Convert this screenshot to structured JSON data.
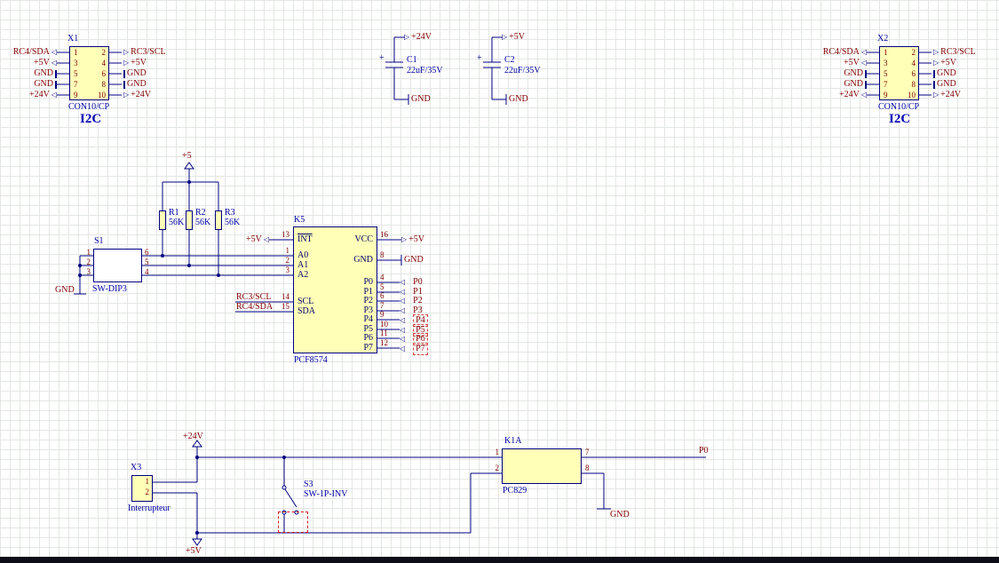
{
  "icons": {
    "port_in": "◁",
    "port_out": "▷"
  },
  "x1": {
    "designator": "X1",
    "type": "CON10/CP",
    "title": "I2C",
    "left": [
      {
        "num": "1",
        "label": "RC4/SDA"
      },
      {
        "num": "3",
        "label": "+5V"
      },
      {
        "num": "5",
        "label": "GND"
      },
      {
        "num": "7",
        "label": "GND"
      },
      {
        "num": "9",
        "label": "+24V"
      }
    ],
    "right": [
      {
        "num": "2",
        "label": "RC3/SCL"
      },
      {
        "num": "4",
        "label": "+5V"
      },
      {
        "num": "6",
        "label": "GND"
      },
      {
        "num": "8",
        "label": "GND"
      },
      {
        "num": "10",
        "label": "+24V"
      }
    ]
  },
  "x2": {
    "designator": "X2",
    "type": "CON10/CP",
    "title": "I2C",
    "left": [
      {
        "num": "1",
        "label": "RC4/SDA"
      },
      {
        "num": "3",
        "label": "+5V"
      },
      {
        "num": "5",
        "label": "GND"
      },
      {
        "num": "7",
        "label": "GND"
      },
      {
        "num": "9",
        "label": "+24V"
      }
    ],
    "right": [
      {
        "num": "2",
        "label": "RC3/SCL"
      },
      {
        "num": "4",
        "label": "+5V"
      },
      {
        "num": "6",
        "label": "GND"
      },
      {
        "num": "8",
        "label": "GND"
      },
      {
        "num": "10",
        "label": "+24V"
      }
    ]
  },
  "caps": {
    "c1": {
      "designator": "C1",
      "value": "22uF/35V",
      "polarity": "+",
      "top_net": "+24V",
      "bottom_net": "GND"
    },
    "c2": {
      "designator": "C2",
      "value": "22uF/35V",
      "polarity": "+",
      "top_net": "+5V",
      "bottom_net": "GND"
    }
  },
  "pullups": {
    "net": "+5",
    "resistors": [
      {
        "designator": "R1",
        "value": "56K"
      },
      {
        "designator": "R2",
        "value": "56K"
      },
      {
        "designator": "R3",
        "value": "56K"
      }
    ]
  },
  "s1": {
    "designator": "S1",
    "type": "SW-DIP3",
    "gnd": "GND",
    "left": [
      {
        "num": "1"
      },
      {
        "num": "2"
      },
      {
        "num": "3"
      }
    ],
    "right": [
      {
        "num": "6"
      },
      {
        "num": "5"
      },
      {
        "num": "4"
      }
    ]
  },
  "k5": {
    "designator": "K5",
    "type": "PCF8574",
    "left": [
      {
        "name": "INT",
        "num": "13",
        "net": "+5V"
      },
      {
        "name": "A0",
        "num": "1"
      },
      {
        "name": "A1",
        "num": "2"
      },
      {
        "name": "A2",
        "num": "3"
      },
      {
        "name": "SCL",
        "num": "14",
        "net": "RC3/SCL"
      },
      {
        "name": "SDA",
        "num": "15",
        "net": "RC4/SDA"
      }
    ],
    "right": [
      {
        "name": "VCC",
        "num": "16",
        "net": "+5V"
      },
      {
        "name": "GND",
        "num": "8",
        "net": "GND"
      },
      {
        "name": "P0",
        "num": "4",
        "net": "P0"
      },
      {
        "name": "P1",
        "num": "5",
        "net": "P1"
      },
      {
        "name": "P2",
        "num": "6",
        "net": "P2"
      },
      {
        "name": "P3",
        "num": "7",
        "net": "P3"
      },
      {
        "name": "P4",
        "num": "9",
        "net": "P4"
      },
      {
        "name": "P5",
        "num": "10",
        "net": "P5"
      },
      {
        "name": "P6",
        "num": "11",
        "net": "P6"
      },
      {
        "name": "P7",
        "num": "12",
        "net": "P7"
      }
    ]
  },
  "bottom": {
    "net_24v": "+24V",
    "net_5v": "+5V",
    "x3": {
      "designator": "X3",
      "type": "Interrupteur",
      "pins": [
        {
          "num": "1"
        },
        {
          "num": "2"
        }
      ]
    },
    "s3": {
      "designator": "S3",
      "type": "SW-1P-INV"
    },
    "k1a": {
      "designator": "K1A",
      "type": "PC829",
      "pins": {
        "p1": "1",
        "p2": "2",
        "p7": "7",
        "p8": "8"
      },
      "out_net": "P0",
      "gnd": "GND"
    }
  }
}
